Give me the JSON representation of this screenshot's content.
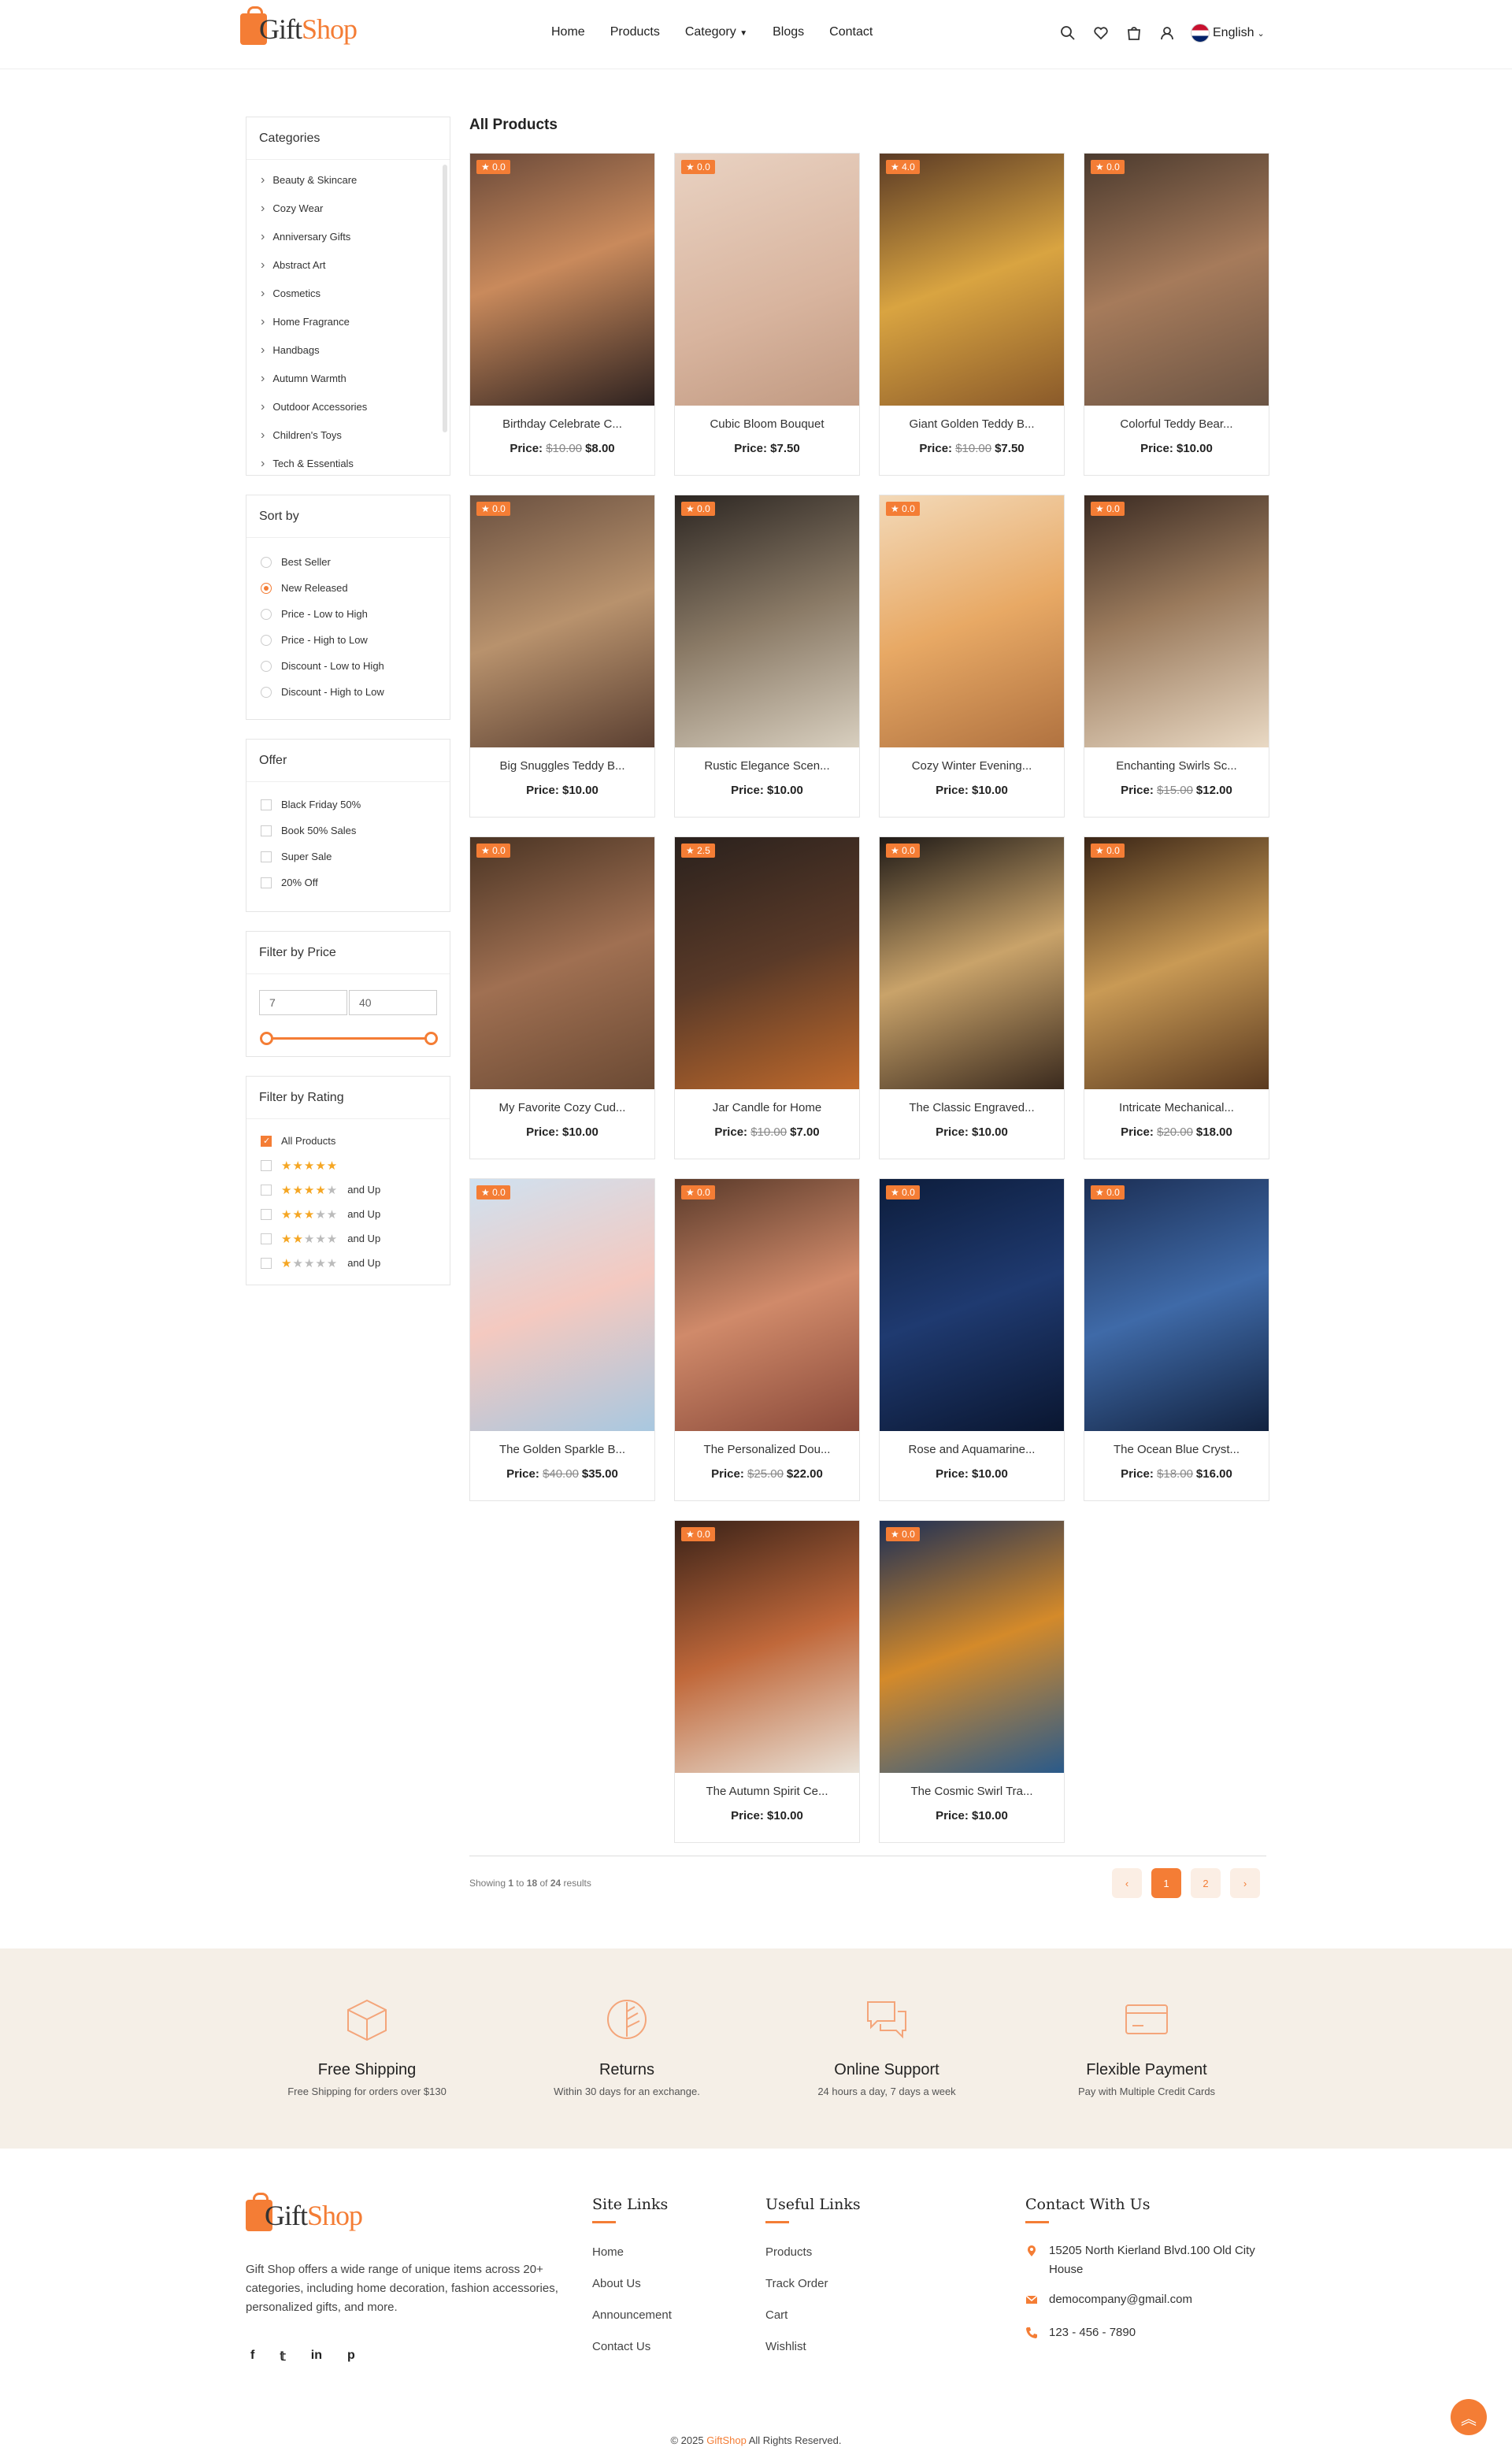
{
  "brand": {
    "name_part1": "Gift",
    "name_part2": "Shop",
    "accent": "#f47d35"
  },
  "nav": [
    "Home",
    "Products",
    "Category",
    "Blogs",
    "Contact"
  ],
  "header_icons": [
    "search-icon",
    "heart-icon",
    "cart-icon",
    "user-icon"
  ],
  "language": "English",
  "categories": {
    "title": "Categories",
    "items": [
      "Beauty & Skincare",
      "Cozy Wear",
      "Anniversary Gifts",
      "Abstract Art",
      "Cosmetics",
      "Home Fragrance",
      "Handbags",
      "Autumn Warmth",
      "Outdoor Accessories",
      "Children's Toys",
      "Tech & Essentials"
    ]
  },
  "sort": {
    "title": "Sort by",
    "options": [
      "Best Seller",
      "New Released",
      "Price - Low to High",
      "Price - High to Low",
      "Discount - Low to High",
      "Discount - High to Low"
    ],
    "selected": "New Released"
  },
  "offer": {
    "title": "Offer",
    "options": [
      "Black Friday 50%",
      "Book 50% Sales",
      "Super Sale",
      "20% Off"
    ]
  },
  "price_filter": {
    "title": "Filter by Price",
    "min": "7",
    "max": "40"
  },
  "rating_filter": {
    "title": "Filter by Rating",
    "all": "All Products",
    "and_up": "and Up",
    "levels": [
      5,
      4,
      3,
      2,
      1
    ]
  },
  "products_title": "All Products",
  "price_label": "Price:",
  "products": [
    {
      "name": "Birthday Celebrate C...",
      "rating": "0.0",
      "old": "$10.00",
      "price": "$8.00"
    },
    {
      "name": "Cubic Bloom Bouquet",
      "rating": "0.0",
      "old": "",
      "price": "$7.50"
    },
    {
      "name": "Giant Golden Teddy B...",
      "rating": "4.0",
      "old": "$10.00",
      "price": "$7.50"
    },
    {
      "name": "Colorful Teddy Bear...",
      "rating": "0.0",
      "old": "",
      "price": "$10.00"
    },
    {
      "name": "Big Snuggles Teddy B...",
      "rating": "0.0",
      "old": "",
      "price": "$10.00"
    },
    {
      "name": "Rustic Elegance Scen...",
      "rating": "0.0",
      "old": "",
      "price": "$10.00"
    },
    {
      "name": "Cozy Winter Evening...",
      "rating": "0.0",
      "old": "",
      "price": "$10.00"
    },
    {
      "name": "Enchanting Swirls Sc...",
      "rating": "0.0",
      "old": "$15.00",
      "price": "$12.00"
    },
    {
      "name": "My Favorite Cozy Cud...",
      "rating": "0.0",
      "old": "",
      "price": "$10.00"
    },
    {
      "name": "Jar Candle for Home",
      "rating": "2.5",
      "old": "$10.00",
      "price": "$7.00"
    },
    {
      "name": "The Classic Engraved...",
      "rating": "0.0",
      "old": "",
      "price": "$10.00"
    },
    {
      "name": "Intricate Mechanical...",
      "rating": "0.0",
      "old": "$20.00",
      "price": "$18.00"
    },
    {
      "name": "The Golden Sparkle B...",
      "rating": "0.0",
      "old": "$40.00",
      "price": "$35.00"
    },
    {
      "name": "The Personalized Dou...",
      "rating": "0.0",
      "old": "$25.00",
      "price": "$22.00"
    },
    {
      "name": "Rose and Aquamarine...",
      "rating": "0.0",
      "old": "",
      "price": "$10.00"
    },
    {
      "name": "The Ocean Blue Cryst...",
      "rating": "0.0",
      "old": "$18.00",
      "price": "$16.00"
    },
    {
      "name": "The Autumn Spirit Ce...",
      "rating": "0.0",
      "old": "",
      "price": "$10.00"
    },
    {
      "name": "The Cosmic Swirl Tra...",
      "rating": "0.0",
      "old": "",
      "price": "$10.00"
    }
  ],
  "pagination": {
    "showing_prefix": "Showing",
    "from": "1",
    "to_word": "to",
    "to": "18",
    "of_word": "of",
    "total": "24",
    "suffix": "results",
    "pages": [
      "‹",
      "1",
      "2",
      "›"
    ],
    "current": "1"
  },
  "features": [
    {
      "title": "Free Shipping",
      "desc": "Free Shipping for orders over $130",
      "icon": "box-icon"
    },
    {
      "title": "Returns",
      "desc": "Within 30 days for an exchange.",
      "icon": "return-leaf-icon"
    },
    {
      "title": "Online Support",
      "desc": "24 hours a day, 7 days a week",
      "icon": "chat-icon"
    },
    {
      "title": "Flexible Payment",
      "desc": "Pay with Multiple Credit Cards",
      "icon": "credit-card-icon"
    }
  ],
  "footer": {
    "about": "Gift Shop offers a wide range of unique items across 20+ categories, including home decoration, fashion accessories, personalized gifts, and more.",
    "site_links_title": "Site Links",
    "site_links": [
      "Home",
      "About Us",
      "Announcement",
      "Contact Us"
    ],
    "useful_links_title": "Useful Links",
    "useful_links": [
      "Products",
      "Track Order",
      "Cart",
      "Wishlist"
    ],
    "contact_title": "Contact With Us",
    "address": "15205 North Kierland Blvd.100 Old City House",
    "email": "democompany@gmail.com",
    "phone": "123 - 456 - 7890",
    "copyright_pre": "© 2025",
    "copyright_brand": "GiftShop",
    "copyright_post": "All Rights Reserved."
  }
}
